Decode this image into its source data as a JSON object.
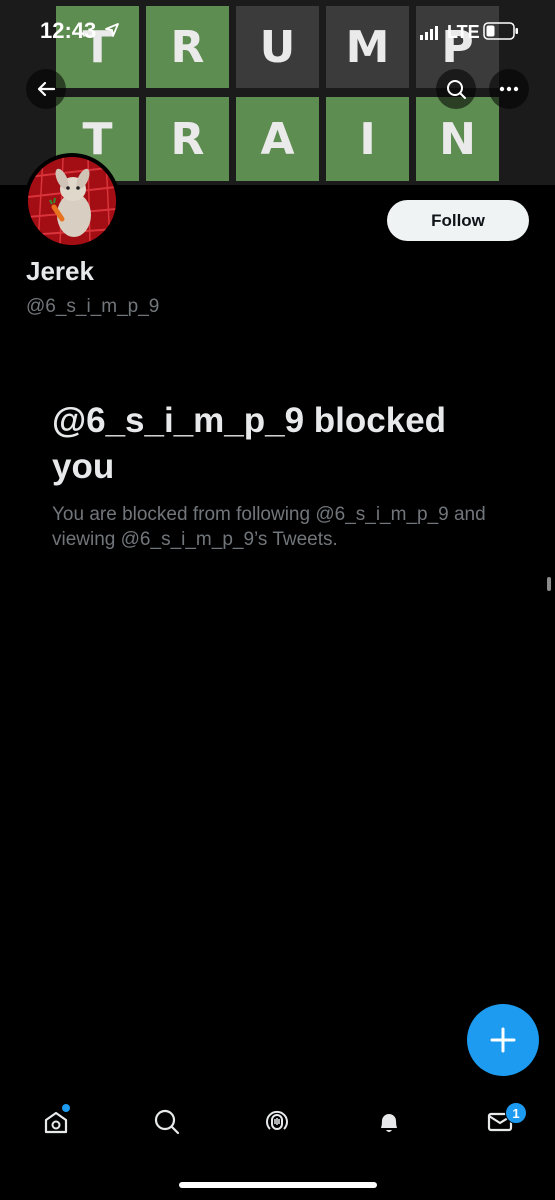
{
  "banner": {
    "row1": [
      "T",
      "R",
      "U",
      "M",
      "P"
    ],
    "row2": [
      "T",
      "R",
      "A",
      "I",
      "N"
    ],
    "colors": {
      "green": "#5e8d51",
      "gray": "#3b3b3b"
    }
  },
  "status_bar": {
    "time": "12:43",
    "carrier": "LTE",
    "icons": [
      "location-arrow-icon",
      "signal-bars-icon",
      "battery-icon"
    ]
  },
  "header": {
    "back_icon": "back-arrow-icon",
    "search_icon": "search-icon",
    "more_icon": "more-icon"
  },
  "profile": {
    "display_name": "Jerek",
    "handle": "@6_s_i_m_p_9",
    "follow_label": "Follow"
  },
  "blocked": {
    "title": "@6_s_i_m_p_9 blocked you",
    "description": "You are blocked from following @6_s_i_m_p_9 and viewing @6_s_i_m_p_9’s Tweets."
  },
  "fab": {
    "icon": "plus-icon",
    "color": "#1d9bf0"
  },
  "tabs": [
    {
      "name": "home",
      "icon": "home-icon",
      "has_dot": true
    },
    {
      "name": "search",
      "icon": "search-icon"
    },
    {
      "name": "spaces",
      "icon": "spaces-icon"
    },
    {
      "name": "notifications",
      "icon": "bell-icon"
    },
    {
      "name": "messages",
      "icon": "mail-icon",
      "badge": "1"
    }
  ]
}
